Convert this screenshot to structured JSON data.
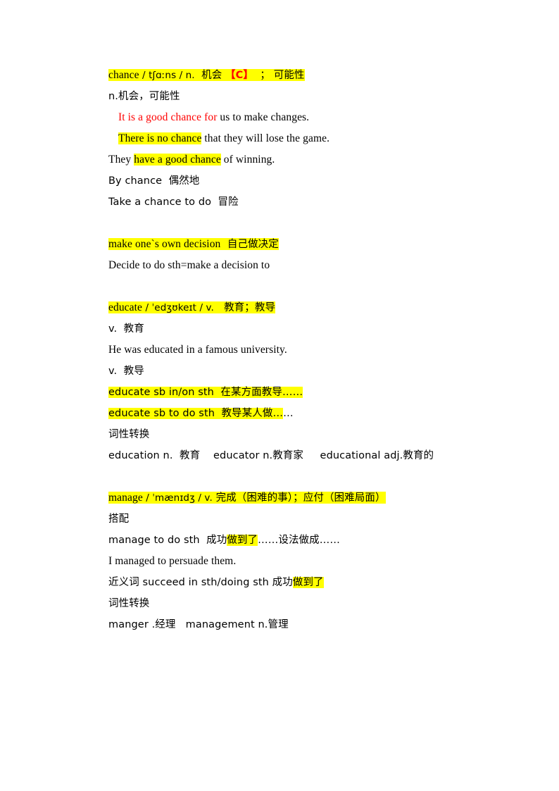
{
  "document": {
    "type": "study-notes",
    "language": "en-zh",
    "background_color": "#ffffff",
    "highlight_color": "#ffff00",
    "accent_color": "#ff0000",
    "text_color": "#000000"
  },
  "entries": [
    {
      "id": "chance",
      "headword_line": {
        "word": "chance",
        "ipa": "/ tʃɑːns / n.",
        "gloss_cn": "机会",
        "bracket_tag": "【C】",
        "separator": "；",
        "gloss_cn_2": "可能性",
        "highlighted": true
      },
      "lines": [
        {
          "text": "n.机会，可能性",
          "highlight": "none",
          "indent": 0,
          "color": "black"
        },
        {
          "text": "It is a good chance for",
          "tail": " us to make changes.",
          "highlight": "none",
          "indent": 1,
          "color": "red-head"
        },
        {
          "head": "There is no chance",
          "tail": " that they will lose the game.",
          "highlight": "head",
          "indent": 1,
          "color": "black"
        },
        {
          "pre": "They ",
          "head": "have a good chance",
          "tail": " of winning.",
          "highlight": "head",
          "indent": 0,
          "color": "black"
        },
        {
          "text": "By chance  偶然地",
          "highlight": "none",
          "indent": 0,
          "color": "black"
        },
        {
          "text": "Take a chance to do  冒险",
          "highlight": "none",
          "indent": 0,
          "color": "black"
        }
      ]
    },
    {
      "id": "make-decision",
      "headword_line": {
        "word": "make one`s own decision",
        "gloss_cn": "自己做决定",
        "highlighted": true
      },
      "lines": [
        {
          "text": "Decide to do sth=make a decision to",
          "highlight": "none",
          "indent": 0,
          "color": "black"
        }
      ]
    },
    {
      "id": "educate",
      "headword_line": {
        "word": "educate",
        "ipa": "/ ˈedʒʊkeɪt / v.",
        "gloss_cn": "教育；教导",
        "highlighted": true
      },
      "lines": [
        {
          "text": "v.  教育",
          "highlight": "none",
          "indent": 0,
          "color": "black"
        },
        {
          "text": "He was educated in a famous university.",
          "highlight": "none",
          "indent": 0,
          "color": "black"
        },
        {
          "text": "v.  教导",
          "highlight": "none",
          "indent": 0,
          "color": "black"
        },
        {
          "head": "educate sb in/on sth  在某方面教导……",
          "highlight": "full",
          "indent": 0,
          "color": "black"
        },
        {
          "head": "educate sb to do sth  教导某人做…",
          "tail": "…",
          "highlight": "head",
          "indent": 0,
          "color": "black"
        },
        {
          "text": "词性转换",
          "highlight": "none",
          "indent": 0,
          "color": "black"
        },
        {
          "text": "education n.  教育    educator n.教育家     educational adj.教育的",
          "highlight": "none",
          "indent": 0,
          "color": "black"
        }
      ]
    },
    {
      "id": "manage",
      "headword_line": {
        "word": "manage",
        "ipa": "/ ˈmænɪdʒ / v.",
        "gloss_cn": "完成（困难的事）；应付（困难局面）",
        "highlighted": true
      },
      "lines": [
        {
          "text": "搭配",
          "highlight": "none",
          "indent": 0,
          "color": "black"
        },
        {
          "pre": "manage to do sth  成功",
          "head": "做到了",
          "tail": "……设法做成……",
          "highlight": "head",
          "indent": 0,
          "color": "black"
        },
        {
          "text": "I managed to persuade them.",
          "highlight": "none",
          "indent": 0,
          "color": "black"
        },
        {
          "pre": "近义词 succeed in sth/doing sth 成功",
          "head": "做到了",
          "tail": "",
          "highlight": "head",
          "indent": 0,
          "color": "black"
        },
        {
          "text": "词性转换",
          "highlight": "none",
          "indent": 0,
          "color": "black"
        },
        {
          "text": "manger .经理   management n.管理",
          "highlight": "none",
          "indent": 0,
          "color": "black"
        }
      ]
    }
  ]
}
